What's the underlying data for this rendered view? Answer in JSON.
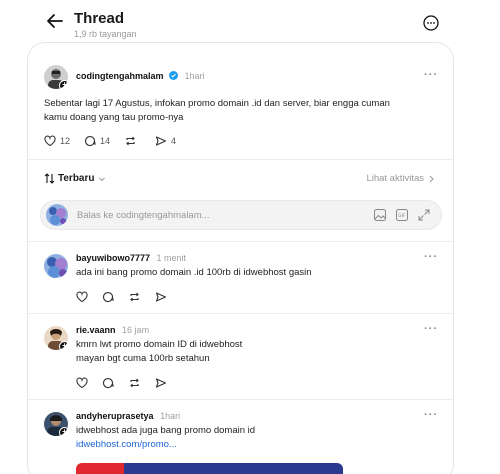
{
  "header": {
    "title": "Thread",
    "views": "1,9 rb tayangan"
  },
  "post": {
    "username": "codingtengahmalam",
    "time": "1hari",
    "text_line1": "Sebentar lagi 17 Agustus, infokan promo domain .id dan server, biar engga cuman",
    "text_line2": "kamu doang yang tau promo-nya",
    "likes": "12",
    "comments": "14",
    "reposts": "",
    "shares": "4"
  },
  "sort": {
    "label": "Terbaru",
    "activity_link": "Lihat aktivitas"
  },
  "reply_box": {
    "placeholder": "Balas ke codingtengahmalam..."
  },
  "comments": [
    {
      "username": "bayuwibowo7777",
      "time": "1 menit",
      "line1": "ada ini bang promo domain .id 100rb di idwebhost gasin",
      "line2": ""
    },
    {
      "username": "rie.vaann",
      "time": "16 jam",
      "line1": "kmrn lwt promo domain ID di idwebhost",
      "line2": "mayan bgt cuma 100rb setahun"
    },
    {
      "username": "andyheruprasetya",
      "time": "1hari",
      "line1": "idwebhost ada juga bang promo domain id",
      "link": "idwebhost.com/promo..."
    }
  ],
  "colors": {
    "accent": "#1d9bf0",
    "link": "#1d66d6",
    "banner_red": "#e0272f",
    "banner_blue": "#2b3990"
  }
}
